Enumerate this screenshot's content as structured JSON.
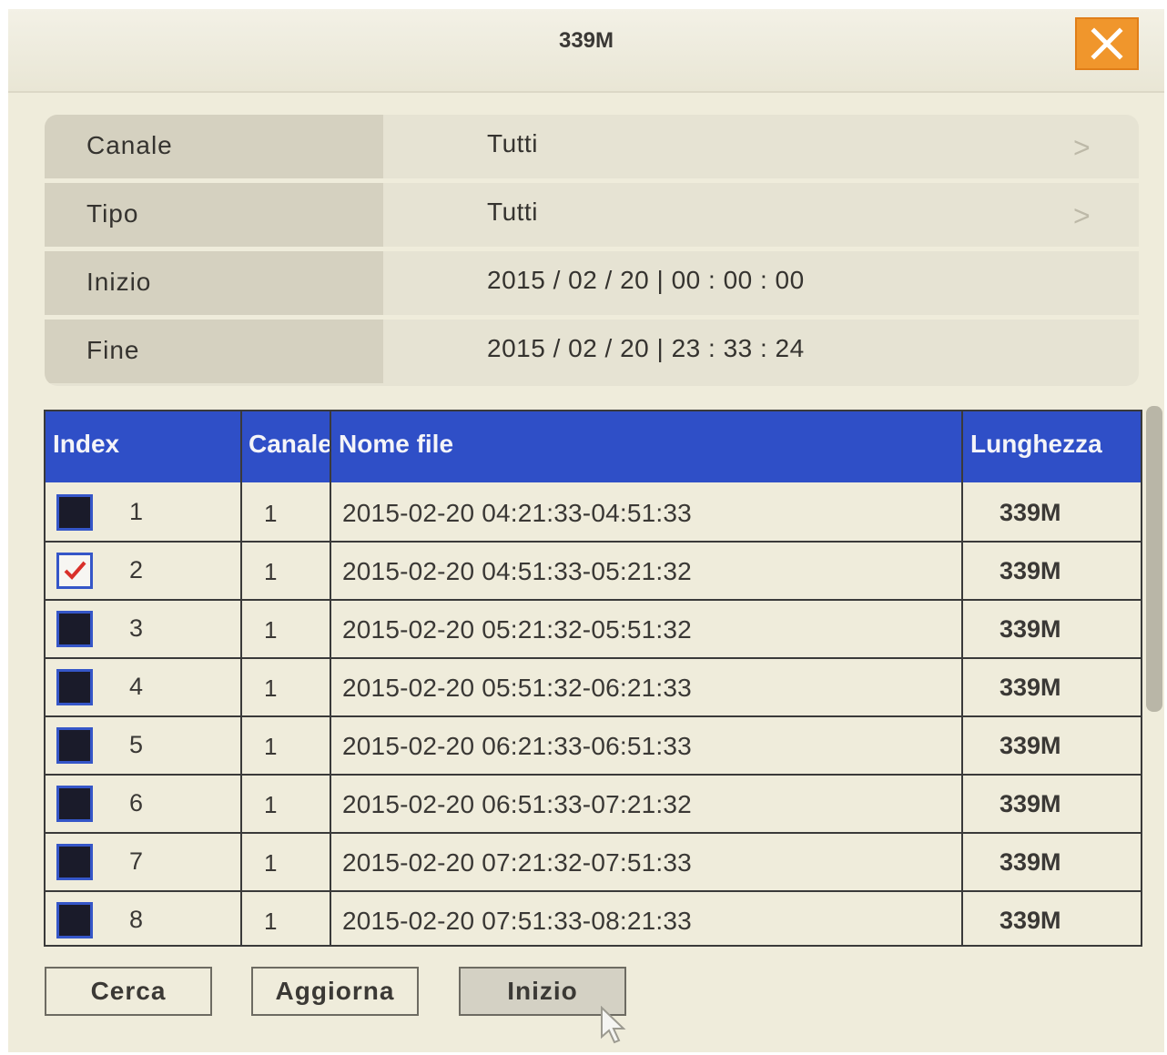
{
  "window": {
    "title": "339M"
  },
  "filters": [
    {
      "label": "Canale",
      "value": "Tutti",
      "has_arrow": true
    },
    {
      "label": "Tipo",
      "value": "Tutti",
      "has_arrow": true
    },
    {
      "label": "Inizio",
      "value": "2015 / 02 / 20 | 00 : 00 : 00",
      "has_arrow": false
    },
    {
      "label": "Fine",
      "value": "2015 / 02 / 20 | 23 : 33 : 24",
      "has_arrow": false
    }
  ],
  "table": {
    "headers": {
      "index": "Index",
      "canale": "Canale",
      "nome_file": "Nome file",
      "lunghezza": "Lunghezza"
    },
    "rows": [
      {
        "checked": false,
        "index": "1",
        "canale": "1",
        "nome_file": "2015-02-20 04:21:33-04:51:33",
        "lunghezza": "339M"
      },
      {
        "checked": true,
        "index": "2",
        "canale": "1",
        "nome_file": "2015-02-20 04:51:33-05:21:32",
        "lunghezza": "339M"
      },
      {
        "checked": false,
        "index": "3",
        "canale": "1",
        "nome_file": "2015-02-20 05:21:32-05:51:32",
        "lunghezza": "339M"
      },
      {
        "checked": false,
        "index": "4",
        "canale": "1",
        "nome_file": "2015-02-20 05:51:32-06:21:33",
        "lunghezza": "339M"
      },
      {
        "checked": false,
        "index": "5",
        "canale": "1",
        "nome_file": "2015-02-20 06:21:33-06:51:33",
        "lunghezza": "339M"
      },
      {
        "checked": false,
        "index": "6",
        "canale": "1",
        "nome_file": "2015-02-20 06:51:33-07:21:32",
        "lunghezza": "339M"
      },
      {
        "checked": false,
        "index": "7",
        "canale": "1",
        "nome_file": "2015-02-20 07:21:32-07:51:33",
        "lunghezza": "339M"
      },
      {
        "checked": false,
        "index": "8",
        "canale": "1",
        "nome_file": "2015-02-20 07:51:33-08:21:33",
        "lunghezza": "339M"
      }
    ]
  },
  "buttons": {
    "cerca": "Cerca",
    "aggiorna": "Aggiorna",
    "inizio": "Inizio"
  },
  "colors": {
    "header_blue": "#2f4fc7",
    "close_orange": "#f0962c",
    "check_red": "#d9302a",
    "background": "#efecdb"
  },
  "icons": {
    "close": "close-icon",
    "arrow": "chevron-right-icon",
    "check": "checkmark-icon",
    "cursor": "mouse-pointer-icon"
  }
}
